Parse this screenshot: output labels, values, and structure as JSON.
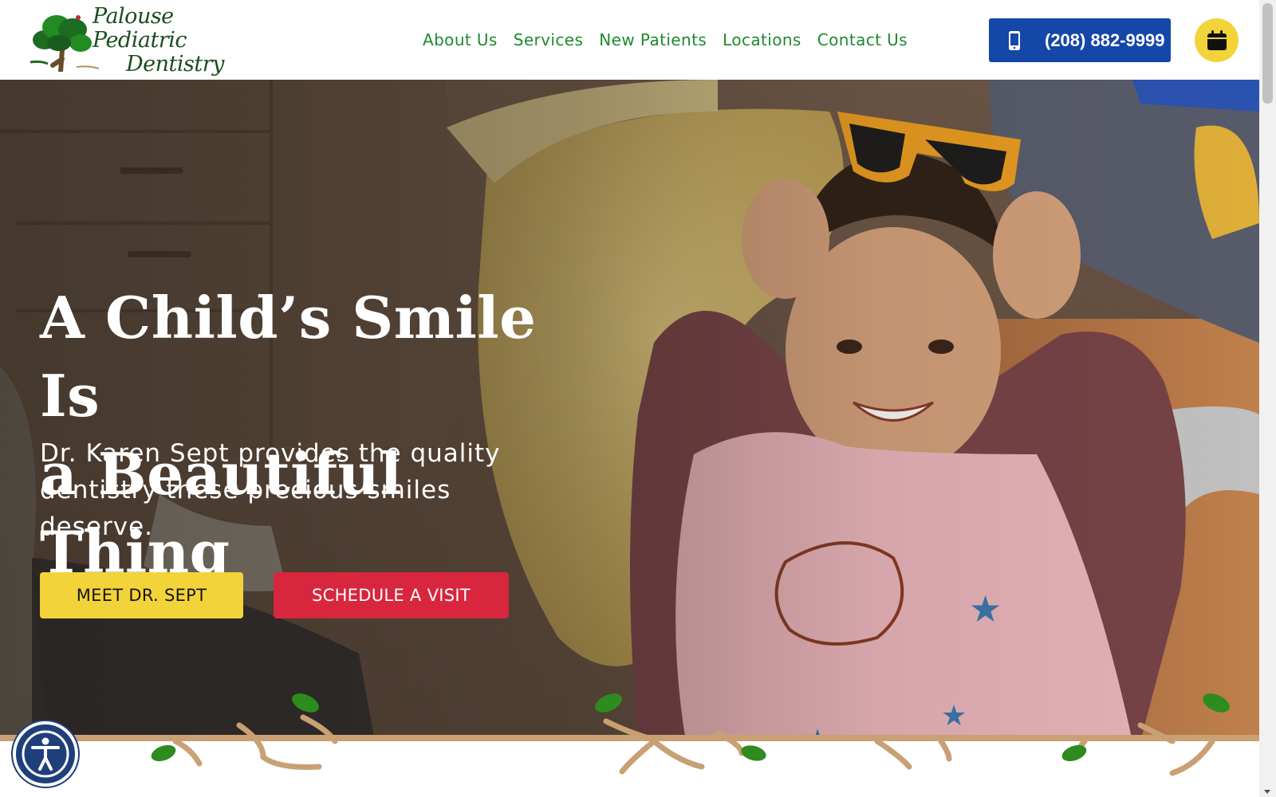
{
  "logo": {
    "line1": "Palouse Pediatric",
    "line2": "Dentistry"
  },
  "nav": {
    "items": [
      {
        "label": "About Us"
      },
      {
        "label": "Services"
      },
      {
        "label": "New Patients"
      },
      {
        "label": "Locations"
      },
      {
        "label": "Contact Us"
      }
    ]
  },
  "header": {
    "phone_label": "(208) 882-9999",
    "phone_icon": "mobile-phone-icon",
    "calendar_icon": "calendar-icon"
  },
  "hero": {
    "title_line1": "A Child’s Smile Is",
    "title_line2": "a Beautiful Thing",
    "subtitle": "Dr. Karen Sept provides the quality dentistry these precious smiles deserve.",
    "meet_button": "MEET DR. SEPT",
    "schedule_button": "SCHEDULE A VISIT"
  },
  "accessibility": {
    "icon": "accessibility-person-icon"
  },
  "colors": {
    "nav_green": "#1e8a2e",
    "logo_green": "#1b4d1e",
    "phone_blue": "#1447a8",
    "accent_yellow": "#f3d33a",
    "accent_red": "#d7263d",
    "branch_tan": "#c9a074",
    "leaf_green": "#2e8b1e"
  }
}
